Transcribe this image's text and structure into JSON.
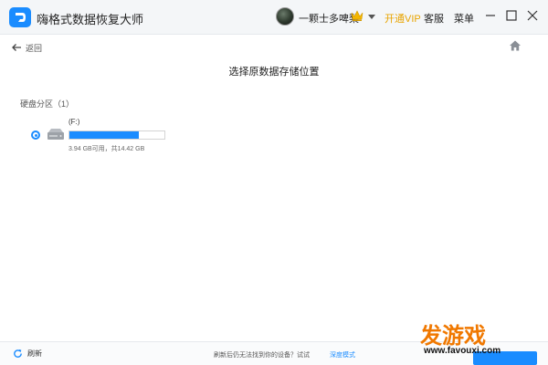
{
  "app": {
    "title": "嗨格式数据恢复大师",
    "username": "一颗士多啤梨",
    "vip_label": "开通VIP",
    "service_label": "客服",
    "menu_label": "菜单"
  },
  "nav": {
    "back_label": "返回"
  },
  "main": {
    "title": "选择原数据存储位置",
    "section_label": "硬盘分区（1）",
    "drives": [
      {
        "name": "(F:)",
        "info": "3.94 GB可用，共14.42 GB",
        "used_fraction": 0.727,
        "selected": true
      }
    ]
  },
  "footer": {
    "refresh_label": "刷新",
    "hint": "刷新后仍无法找到你的设备？试试",
    "hint_link": "深度模式"
  },
  "watermark": {
    "brand": "发游戏",
    "url": "www.favouxi.com"
  },
  "colors": {
    "accent": "#1a8cff",
    "vip": "#e8a400",
    "watermark": "#f07800"
  }
}
